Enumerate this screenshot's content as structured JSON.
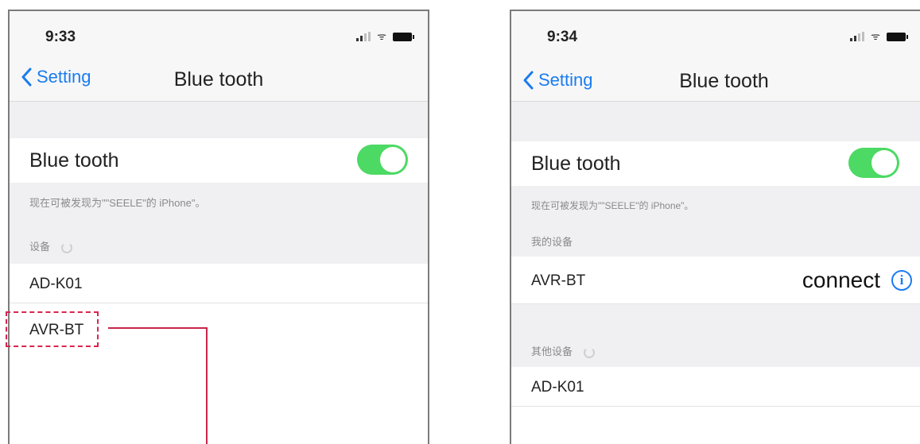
{
  "left_screen": {
    "time": "9:33",
    "nav": {
      "back_label": "Setting",
      "title": "Blue tooth"
    },
    "bluetooth_label": "Blue tooth",
    "bluetooth_on": true,
    "discoverable_note": "现在可被发现为\"\"SEELE\"的 iPhone\"。",
    "devices_header": "设备",
    "devices": [
      "AD-K01",
      "AVR-BT"
    ]
  },
  "right_screen": {
    "time": "9:34",
    "nav": {
      "back_label": "Setting",
      "title": "Blue tooth"
    },
    "bluetooth_label": "Blue tooth",
    "bluetooth_on": true,
    "discoverable_note": "现在可被发现为\"\"SEELE\"的 iPhone\"。",
    "my_devices_header": "我的设备",
    "my_devices": [
      {
        "name": "AVR-BT",
        "status": "connect"
      }
    ],
    "other_devices_header": "其他设备",
    "other_devices": [
      "AD-K01"
    ]
  },
  "colors": {
    "ios_blue": "#1a7cf0",
    "toggle_green": "#4cd964",
    "highlight_red": "#d9254f"
  },
  "icons": [
    "chevron-left-icon",
    "signal-icon",
    "wifi-icon",
    "battery-icon",
    "spinner-icon",
    "info-icon"
  ]
}
